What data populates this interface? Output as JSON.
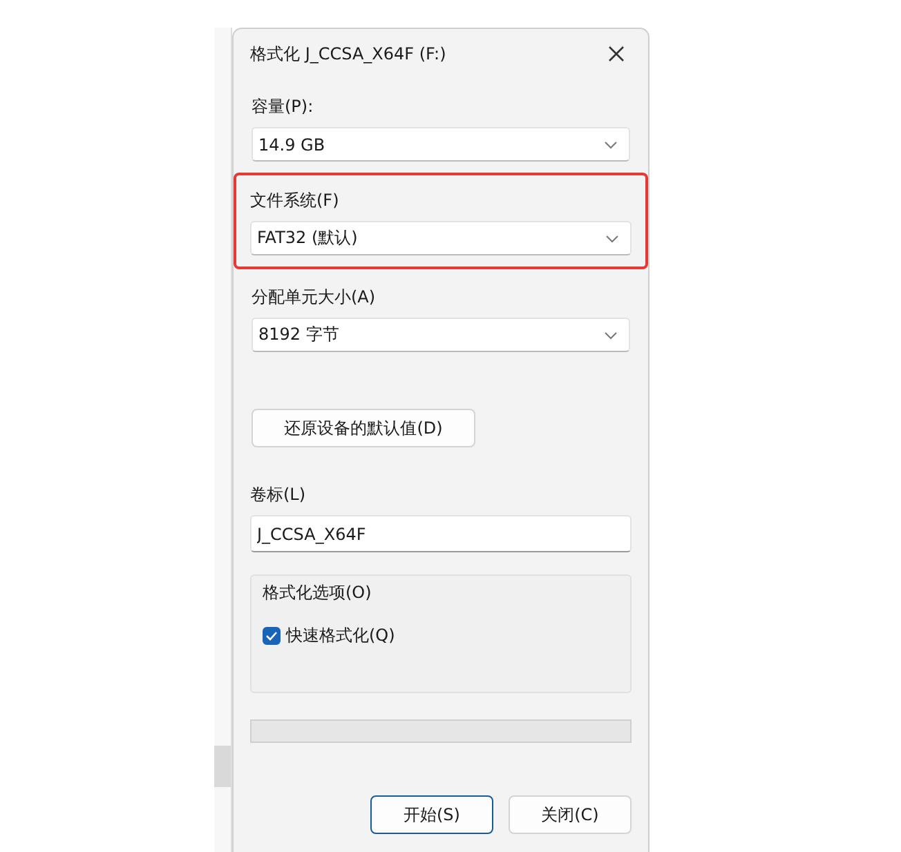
{
  "window": {
    "title": "格式化 J_CCSA_X64F (F:)"
  },
  "fields": [
    {
      "kind": "dropdown",
      "label": "容量(P):",
      "value": "14.9 GB",
      "highlighted": false
    },
    {
      "kind": "dropdown",
      "label": "文件系统(F)",
      "value": "FAT32 (默认)",
      "highlighted": true
    },
    {
      "kind": "dropdown",
      "label": "分配单元大小(A)",
      "value": "8192 字节",
      "highlighted": false
    }
  ],
  "restore_button": "还原设备的默认值(D)",
  "volume_label": {
    "label": "卷标(L)",
    "value": "J_CCSA_X64F"
  },
  "options": {
    "title": "格式化选项(O)",
    "checkboxes": [
      {
        "label": "快速格式化(Q)",
        "checked": true
      }
    ]
  },
  "progress": {
    "level": 0
  },
  "buttons": [
    {
      "label": "开始(S)",
      "default": true
    },
    {
      "label": "关闭(C)",
      "default": false
    }
  ]
}
